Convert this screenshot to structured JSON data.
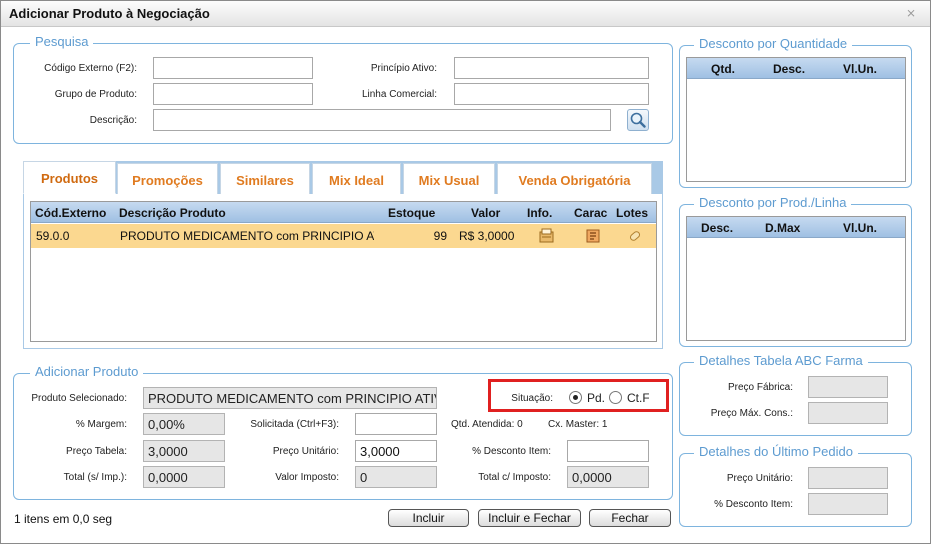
{
  "window": {
    "title": "Adicionar Produto à Negociação",
    "close_glyph": "⨯"
  },
  "search": {
    "legend": "Pesquisa",
    "codigo_externo_label": "Código Externo (F2):",
    "principio_ativo_label": "Princípio Ativo:",
    "grupo_produto_label": "Grupo de Produto:",
    "linha_comercial_label": "Linha Comercial:",
    "descricao_label": "Descrição:",
    "codigo_externo_value": "",
    "principio_ativo_value": "",
    "grupo_produto_value": "",
    "linha_comercial_value": "",
    "descricao_value": ""
  },
  "tabs": [
    {
      "label": "Produtos",
      "active": true
    },
    {
      "label": "Promoções",
      "active": false
    },
    {
      "label": "Similares",
      "active": false
    },
    {
      "label": "Mix Ideal",
      "active": false
    },
    {
      "label": "Mix Usual",
      "active": false
    },
    {
      "label": "Venda Obrigatória",
      "active": false
    }
  ],
  "products": {
    "columns": [
      "Cód.Externo",
      "Descrição Produto",
      "Estoque",
      "Valor",
      "Info.",
      "Carac",
      "Lotes"
    ],
    "rows": [
      {
        "codigo": "59.0.0",
        "descricao": "PRODUTO MEDICAMENTO com PRINCIPIO ATIVO",
        "estoque": "99",
        "valor": "R$ 3,0000"
      }
    ]
  },
  "adicionar": {
    "legend": "Adicionar Produto",
    "produto_selecionado_label": "Produto Selecionado:",
    "produto_selecionado_value": "PRODUTO MEDICAMENTO com PRINCIPIO ATIVO",
    "situacao_label": "Situação:",
    "situacao_options": [
      "Pd.",
      "Ct.F"
    ],
    "situacao_selected": "Pd.",
    "margem_label": "% Margem:",
    "margem_value": "0,00%",
    "solicitada_label": "Solicitada (Ctrl+F3):",
    "solicitada_value": "",
    "qtd_atendida_label": "Qtd. Atendida: 0",
    "cx_master_label": "Cx. Master: 1",
    "preco_tabela_label": "Preço Tabela:",
    "preco_tabela_value": "3,0000",
    "preco_unitario_label": "Preço Unitário:",
    "preco_unitario_value": "3,0000",
    "desconto_item_label": "% Desconto Item:",
    "desconto_item_value": "",
    "total_s_imp_label": "Total (s/ Imp.):",
    "total_s_imp_value": "0,0000",
    "valor_imposto_label": "Valor Imposto:",
    "valor_imposto_value": "0",
    "total_c_imposto_label": "Total c/ Imposto:",
    "total_c_imposto_value": "0,0000"
  },
  "desconto_quantidade": {
    "legend": "Desconto por Quantidade",
    "columns": [
      "Qtd.",
      "Desc.",
      "Vl.Un."
    ]
  },
  "desconto_prod_linha": {
    "legend": "Desconto por Prod./Linha",
    "columns": [
      "Desc.",
      "D.Max",
      "Vl.Un."
    ]
  },
  "abc_farma": {
    "legend": "Detalhes Tabela ABC Farma",
    "preco_fabrica_label": "Preço Fábrica:",
    "preco_max_cons_label": "Preço Máx. Cons.:",
    "preco_fabrica_value": "",
    "preco_max_cons_value": ""
  },
  "ultimo_pedido": {
    "legend": "Detalhes do Último Pedido",
    "preco_unitario_label": "Preço Unitário:",
    "desconto_item_label": "% Desconto Item:",
    "preco_unitario_value": "",
    "desconto_item_value": ""
  },
  "footer": {
    "status": "1 itens em 0,0 seg",
    "incluir": "Incluir",
    "incluir_fechar": "Incluir e Fechar",
    "fechar": "Fechar"
  }
}
